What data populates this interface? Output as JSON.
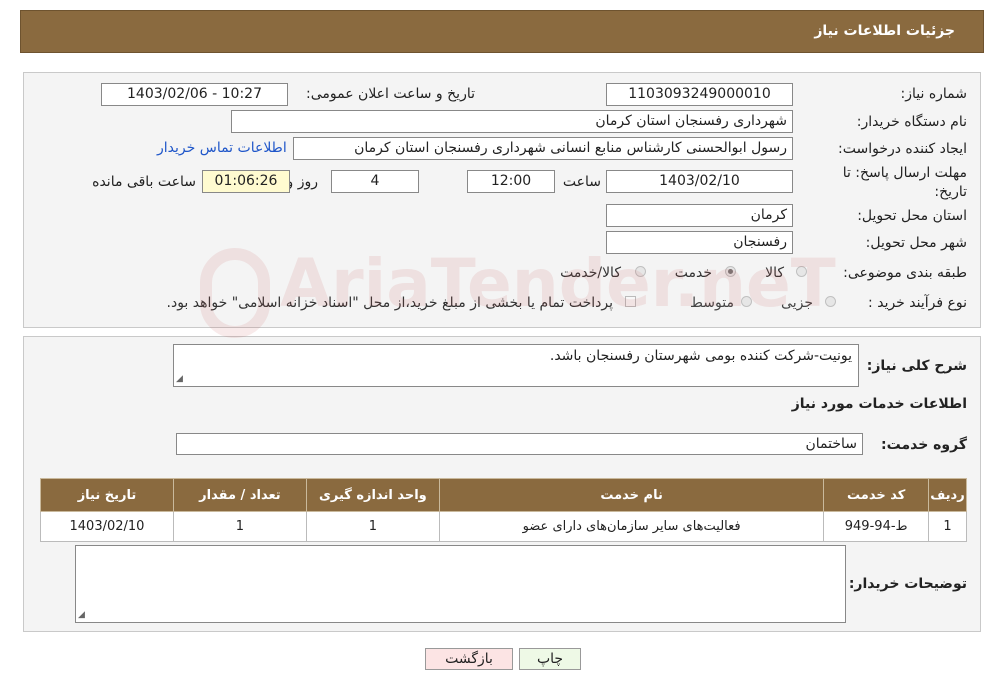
{
  "header": {
    "title": "جزئیات اطلاعات نیاز"
  },
  "form": {
    "need_number_label": "شماره نیاز:",
    "need_number": "1103093249000010",
    "announce_label": "تاریخ و ساعت اعلان عمومی:",
    "announce_value": "1403/02/06 - 10:27",
    "buyer_org_label": "نام دستگاه خریدار:",
    "buyer_org": "شهرداری رفسنجان استان کرمان",
    "creator_label": "ایجاد کننده درخواست:",
    "creator": "رسول ابوالحسنی کارشناس منابع انسانی شهرداری رفسنجان استان کرمان",
    "contact_link": "اطلاعات تماس خریدار",
    "deadline_label_1": "مهلت ارسال پاسخ: تا",
    "deadline_label_2": "تاریخ:",
    "deadline_date": "1403/02/10",
    "time_label": "ساعت",
    "deadline_time": "12:00",
    "days_value": "4",
    "days_label": "روز و",
    "remaining_time": "01:06:26",
    "remaining_label": "ساعت باقی مانده",
    "province_label": "استان محل تحویل:",
    "province": "کرمان",
    "city_label": "شهر محل تحویل:",
    "city": "رفسنجان",
    "category_label": "طبقه بندی موضوعی:",
    "category_options": [
      "کالا",
      "خدمت",
      "کالا/خدمت"
    ],
    "category_selected": "خدمت",
    "purchase_type_label": "نوع فرآیند خرید :",
    "purchase_options": [
      "جزیی",
      "متوسط"
    ],
    "payment_note": "پرداخت تمام یا بخشی از مبلغ خرید،از محل \"اسناد خزانه اسلامی\" خواهد بود."
  },
  "details": {
    "summary_label": "شرح کلی نیاز:",
    "summary": "یونیت-شرکت کننده بومی شهرستان رفسنجان باشد.",
    "services_title": "اطلاعات خدمات مورد نیاز",
    "service_group_label": "گروه خدمت:",
    "service_group": "ساختمان",
    "table_headers": [
      "ردیف",
      "کد خدمت",
      "نام خدمت",
      "واحد اندازه گیری",
      "تعداد / مقدار",
      "تاریخ نیاز"
    ],
    "rows": [
      [
        "1",
        "ط-94-949",
        "فعالیت‌های سایر سازمان‌های دارای عضو",
        "1",
        "1",
        "1403/02/10"
      ]
    ],
    "buyer_notes_label": "توضیحات خریدار:",
    "buyer_notes": ""
  },
  "buttons": {
    "print": "چاپ",
    "back": "بازگشت"
  },
  "watermark": "AriaTender.neT",
  "colors": {
    "header_bg": "#8a6a3f",
    "link": "#1f56c9",
    "back_button_bg": "#fce4e4",
    "print_button_bg": "#eef9e6"
  }
}
